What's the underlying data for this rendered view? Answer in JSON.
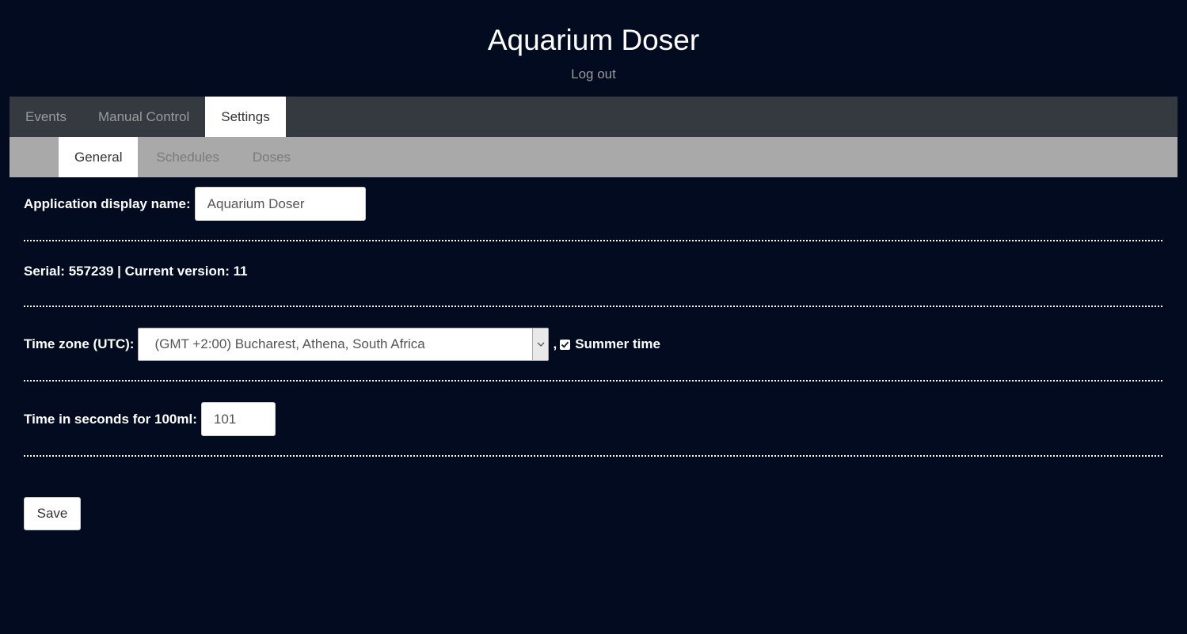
{
  "header": {
    "title": "Aquarium Doser",
    "logout_label": "Log out"
  },
  "main_tabs": [
    {
      "label": "Events"
    },
    {
      "label": "Manual Control"
    },
    {
      "label": "Settings",
      "active": true
    }
  ],
  "sub_tabs": [
    {
      "label": "General",
      "active": true
    },
    {
      "label": "Schedules"
    },
    {
      "label": "Doses"
    }
  ],
  "general": {
    "display_name_label": "Application display name:",
    "display_name_value": "Aquarium Doser",
    "serial_text": "Serial: 557239 | Current version: 11",
    "timezone_label": "Time zone (UTC):",
    "timezone_value": "(GMT +2:00) Bucharest, Athena, South Africa",
    "timezone_separator": ",",
    "summer_time_label": "Summer time",
    "summer_time_checked": true,
    "time_100ml_label": "Time in seconds for 100ml:",
    "time_100ml_value": "101",
    "save_label": "Save"
  },
  "icons": {
    "select_arrow": "chevron-down-icon",
    "checkbox_mark": "checkmark-icon"
  },
  "colors": {
    "background": "#020b20",
    "main_tab_bar": "#343a40",
    "sub_tab_bar": "#a9a9a9",
    "active_tab": "#ffffff"
  }
}
